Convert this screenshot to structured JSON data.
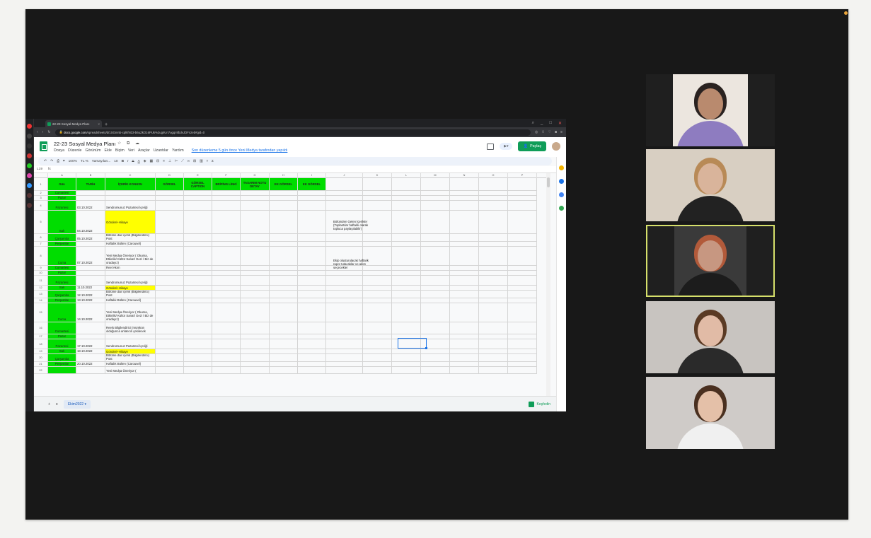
{
  "browser": {
    "tab_title": "22-23 Sosyal Medya Planı",
    "url_host": "docs.google.com",
    "url_path": "/spreadsheets/d/1SGmnb-cplkfN33-b6uZkO16PUk%2ugiIUn7ugqmfbdvJDF4zeb#gid=0"
  },
  "sheet": {
    "title": "22-23 Sosyal Medya Planı",
    "menu": [
      "Dosya",
      "Düzenle",
      "Görünüm",
      "Ekle",
      "Biçim",
      "Veri",
      "Araçlar",
      "Uzantılar",
      "Yardım"
    ],
    "last_edit": "Son düzenleme 5 gün önce Yeni Medya tarafından yapıldı",
    "share_label": "Paylaş",
    "zoom": "100%",
    "font": "Varsayılan...",
    "font_size": "10",
    "name_box": "L19",
    "sheet_tab": "Ekim2022",
    "explore_label": "Keşfedin",
    "columns": [
      "A",
      "B",
      "C",
      "D",
      "E",
      "F",
      "G",
      "H",
      "I",
      "J",
      "K",
      "L",
      "M",
      "N",
      "O",
      "P"
    ],
    "headers": [
      "Gün",
      "TARİH",
      "İÇERİK KONUSU",
      "GÖRSEL",
      "GÖRSEL CAPTION",
      "BRİFİNG LİNKİ",
      "TASARIM NOTU DETAY",
      "EK GÖRSEL",
      "EK GÖRSEL"
    ],
    "rows": [
      {
        "n": "2",
        "day": "Cumartesi",
        "date": "",
        "topic": "",
        "yellow": false
      },
      {
        "n": "3",
        "day": "Pazar",
        "date": "",
        "topic": "",
        "yellow": false
      },
      {
        "n": "4",
        "day": "Pazartesi",
        "date": "03.10.2022",
        "topic": "Sendromunuz Pazartesi İçeriği",
        "yellow": false
      },
      {
        "n": "5",
        "day": "Salı",
        "date": "04.10.2022",
        "topic": "Gönderi+Hikaye",
        "yellow": true
      },
      {
        "n": "6",
        "day": "Çarşamba",
        "date": "05.10.2022",
        "topic": "Bölüme dair içerik (Bilgilendirici) Post",
        "yellow": false
      },
      {
        "n": "7",
        "day": "Perşembe",
        "date": "",
        "topic": "Haftalık Bülten (Carousel)",
        "yellow": false
      },
      {
        "n": "8",
        "day": "Cuma",
        "date": "07.10.2022",
        "topic": "Yeni Medya Öneriyor ( Okuma, Etkinlik/ Kültür Sanat/ Gezi / Biz de oradayız)",
        "yellow": false
      },
      {
        "n": "9",
        "day": "Cumartesi",
        "date": "",
        "topic": "Reel Akım",
        "yellow": false
      },
      {
        "n": "10",
        "day": "Pazar",
        "date": "",
        "topic": "",
        "yellow": false
      },
      {
        "n": "11",
        "day": "Pazartesi",
        "date": "",
        "topic": "Sendromunuz Pazartesi İçeriği",
        "yellow": false
      },
      {
        "n": "12",
        "day": "Salı",
        "date": "11.10.2022",
        "topic": "Gönderi+Hikaye",
        "yellow": true
      },
      {
        "n": "13",
        "day": "Çarşamba",
        "date": "12.10.2022",
        "topic": "Bölüme dair içerik (Bilgilendirici) Post",
        "yellow": false
      },
      {
        "n": "14",
        "day": "Perşembe",
        "date": "13.10.2022",
        "topic": "Haftalık Bülten (Carousel)",
        "yellow": false
      },
      {
        "n": "15",
        "day": "Cuma",
        "date": "14.10.2022",
        "topic": "Yeni Medya Öneriyor ( Okuma, Etkinlik/ Kültür Sanat/ Gezi / Biz de oradayız)",
        "yellow": false
      },
      {
        "n": "16",
        "day": "Cumartesi",
        "date": "",
        "topic": "Reels Bilgilendirici (mümkün olduğunca anlatıcılı çekilecek",
        "yellow": false
      },
      {
        "n": "17",
        "day": "Pazar",
        "date": "",
        "topic": "",
        "yellow": false
      },
      {
        "n": "18",
        "day": "Pazartesi",
        "date": "17.10.2022",
        "topic": "Sendromunuz Pazartesi İçeriği",
        "yellow": false
      },
      {
        "n": "19",
        "day": "Salı",
        "date": "18.10.2022",
        "topic": "Gönderi+Hikaye",
        "yellow": true
      },
      {
        "n": "20",
        "day": "Çarşamba",
        "date": "",
        "topic": "Bölüme dair içerik (Bilgilendirici) Post",
        "yellow": false
      },
      {
        "n": "21",
        "day": "Perşembe",
        "date": "20.10.2022",
        "topic": "Haftalık Bülten (Carousel)",
        "yellow": false
      },
      {
        "n": "22",
        "day": "",
        "date": "",
        "topic": "Yeni Medya Öneriyor (",
        "yellow": false
      }
    ],
    "note1": "Bölümden Gelen İçerikler (Toplantılar haftalık olarak topluca paylaşılabilir)",
    "note2": "Ekip oluşturulacak haftalık rapor tutacaklar ve akım seçecekler"
  },
  "participants": [
    {
      "name": "participant-1",
      "bg": "#ece6df",
      "skin": "#b98a6e",
      "hair": "#2a2220",
      "shirt": "#8e7cc0"
    },
    {
      "name": "participant-2",
      "bg": "#d8cfc2",
      "skin": "#d9b49b",
      "hair": "#b88a57",
      "shirt": "#222"
    },
    {
      "name": "participant-3",
      "bg": "#3a3a3a",
      "skin": "#c79781",
      "hair": "#b25a3a",
      "shirt": "#1c1c1c"
    },
    {
      "name": "participant-4",
      "bg": "#c8c4c0",
      "skin": "#e1bba6",
      "hair": "#5a3a24",
      "shirt": "#2a2a2a"
    },
    {
      "name": "participant-5",
      "bg": "#cfcbc8",
      "skin": "#e4c0a8",
      "hair": "#4a3020",
      "shirt": "#f0f0f0"
    }
  ]
}
